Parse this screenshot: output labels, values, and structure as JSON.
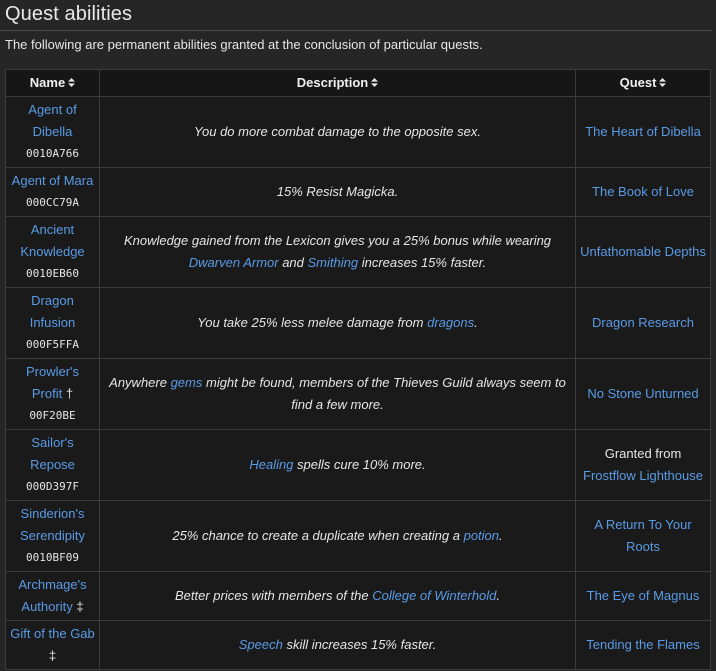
{
  "page": {
    "heading": "Quest abilities",
    "intro": "The following are permanent abilities granted at the conclusion of particular quests."
  },
  "table": {
    "headers": {
      "name": "Name",
      "description": "Description",
      "quest": "Quest"
    },
    "rows": [
      {
        "name": "Agent of Dibella",
        "name_lines": [
          "Agent of",
          "Dibella"
        ],
        "form_id": "0010A766",
        "mark": "",
        "description_parts": [
          {
            "text": "You do more combat damage to the opposite sex.",
            "link": false
          }
        ],
        "quest_lines": [
          {
            "text": "The Heart of Dibella",
            "link": true
          }
        ]
      },
      {
        "name": "Agent of Mara",
        "name_lines": [
          "Agent of Mara"
        ],
        "form_id": "000CC79A",
        "mark": "",
        "description_parts": [
          {
            "text": "15% Resist Magicka.",
            "link": false
          }
        ],
        "quest_lines": [
          {
            "text": "The Book of Love",
            "link": true
          }
        ]
      },
      {
        "name": "Ancient Knowledge",
        "name_lines": [
          "Ancient",
          "Knowledge"
        ],
        "form_id": "0010EB60",
        "mark": "",
        "description_parts": [
          {
            "text": "Knowledge gained from the Lexicon gives you a 25% bonus while wearing ",
            "link": false
          },
          {
            "text": "Dwarven Armor",
            "link": true
          },
          {
            "text": " and ",
            "link": false
          },
          {
            "text": "Smithing",
            "link": true
          },
          {
            "text": " increases 15% faster.",
            "link": false
          }
        ],
        "quest_lines": [
          {
            "text": "Unfathomable Depths",
            "link": true
          }
        ]
      },
      {
        "name": "Dragon Infusion",
        "name_lines": [
          "Dragon",
          "Infusion"
        ],
        "form_id": "000F5FFA",
        "mark": "",
        "description_parts": [
          {
            "text": "You take 25% less melee damage from ",
            "link": false
          },
          {
            "text": "dragons",
            "link": true
          },
          {
            "text": ".",
            "link": false
          }
        ],
        "quest_lines": [
          {
            "text": "Dragon Research",
            "link": true
          }
        ]
      },
      {
        "name": "Prowler's Profit",
        "name_lines": [
          "Prowler's",
          "Profit"
        ],
        "form_id": "00F20BE",
        "mark": "†",
        "description_parts": [
          {
            "text": "Anywhere ",
            "link": false
          },
          {
            "text": "gems",
            "link": true
          },
          {
            "text": " might be found, members of the Thieves Guild always seem to find a few more.",
            "link": false
          }
        ],
        "quest_lines": [
          {
            "text": "No Stone Unturned",
            "link": true
          }
        ]
      },
      {
        "name": "Sailor's Repose",
        "name_lines": [
          "Sailor's",
          "Repose"
        ],
        "form_id": "000D397F",
        "mark": "",
        "description_parts": [
          {
            "text": "Healing",
            "link": true
          },
          {
            "text": " spells cure 10% more.",
            "link": false
          }
        ],
        "quest_lines": [
          {
            "text": "Granted from",
            "link": false
          },
          {
            "text": "Frostflow Lighthouse",
            "link": true
          }
        ]
      },
      {
        "name": "Sinderion's Serendipity",
        "name_lines": [
          "Sinderion's",
          "Serendipity"
        ],
        "form_id": "0010BF09",
        "mark": "",
        "description_parts": [
          {
            "text": "25% chance to create a duplicate when creating a ",
            "link": false
          },
          {
            "text": "potion",
            "link": true
          },
          {
            "text": ".",
            "link": false
          }
        ],
        "quest_lines": [
          {
            "text": "A Return To Your",
            "link": true
          },
          {
            "text": "Roots",
            "link": true
          }
        ]
      },
      {
        "name": "Archmage's Authority",
        "name_lines": [
          "Archmage's",
          "Authority"
        ],
        "form_id": "",
        "mark": "‡",
        "description_parts": [
          {
            "text": "Better prices with members of the ",
            "link": false
          },
          {
            "text": "College of Winterhold",
            "link": true
          },
          {
            "text": ".",
            "link": false
          }
        ],
        "quest_lines": [
          {
            "text": "The Eye of Magnus",
            "link": true
          }
        ]
      },
      {
        "name": "Gift of the Gab",
        "name_lines": [
          "Gift of the Gab"
        ],
        "form_id": "",
        "mark": "‡",
        "mark_on_new_line": true,
        "description_parts": [
          {
            "text": "Speech",
            "link": true
          },
          {
            "text": " skill increases 15% faster.",
            "link": false
          }
        ],
        "quest_lines": [
          {
            "text": "Tending the Flames",
            "link": true
          }
        ]
      }
    ]
  },
  "colors": {
    "page_background": "#262626",
    "table_background": "#1a1a1a",
    "header_background": "#161616",
    "link": "#5a9be6",
    "text": "#e6e6e6",
    "border": "#3c3c3c"
  },
  "icons": {
    "sort": "sort-icon"
  }
}
